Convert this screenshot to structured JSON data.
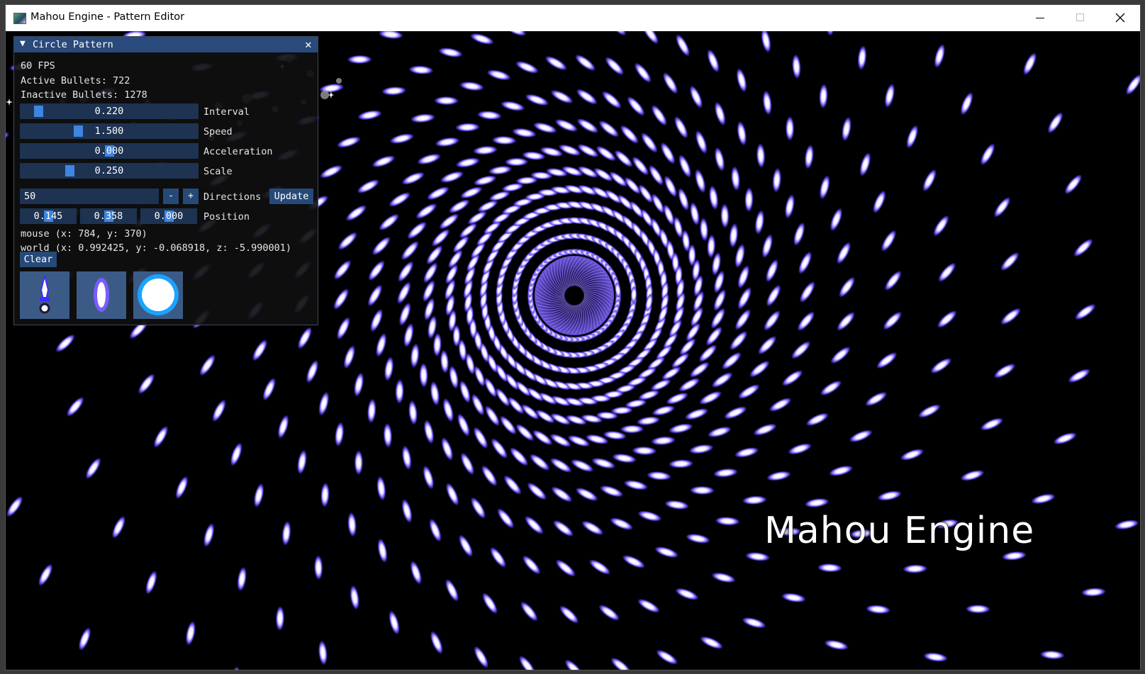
{
  "window": {
    "title": "Mahou Engine - Pattern Editor"
  },
  "panel": {
    "title": "Circle Pattern",
    "fps": "60 FPS",
    "active_bullets": "Active Bullets: 722",
    "inactive_bullets": "Inactive Bullets: 1278",
    "sliders": [
      {
        "label": "Interval",
        "value": "0.220",
        "level": 0.07
      },
      {
        "label": "Speed",
        "value": "1.500",
        "level": 0.31
      },
      {
        "label": "Acceleration",
        "value": "0.000",
        "level": 0.5
      },
      {
        "label": "Scale",
        "value": "0.250",
        "level": 0.26
      }
    ],
    "directions": {
      "label": "Directions",
      "value": "50",
      "minus": "-",
      "plus": "+",
      "update_label": "Update"
    },
    "position": {
      "label": "Position",
      "values": [
        {
          "value": "0.145",
          "level": 0.5
        },
        {
          "value": "0.358",
          "level": 0.5
        },
        {
          "value": "0.000",
          "level": 0.5
        }
      ]
    },
    "mouse": "mouse (x: 784, y: 370)",
    "world": "world (x: 0.992425, y: -0.068918, z: -5.990001)",
    "clear_label": "Clear",
    "bullet_types": [
      "sword-bullet-icon",
      "ellipse-bullet-icon",
      "orb-bullet-icon"
    ]
  },
  "scene": {
    "logo_text": "Mahou Engine",
    "bullet_color": "#7a5cff",
    "bullet_core": "#ffffff",
    "background": "#000000"
  }
}
